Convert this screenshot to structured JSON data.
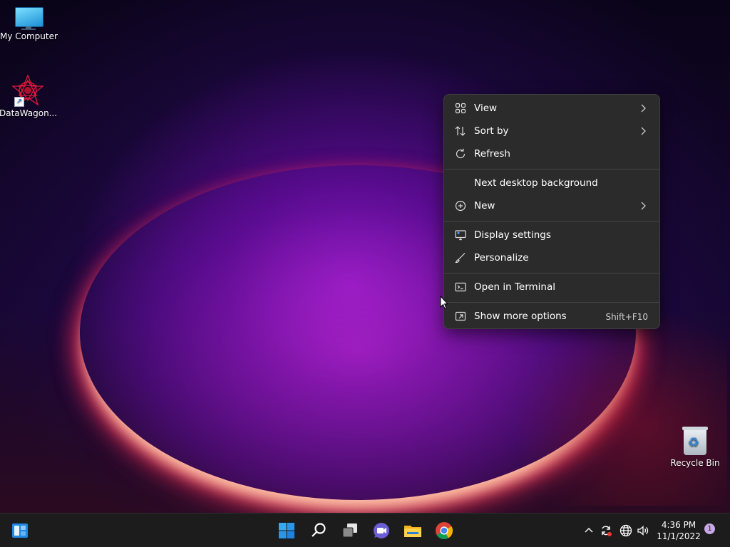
{
  "desktop": {
    "icons": [
      {
        "label": "My Computer"
      },
      {
        "label": "DataWagon..."
      },
      {
        "label": "Recycle Bin"
      }
    ]
  },
  "context_menu": {
    "items": [
      {
        "label": "View",
        "icon": "grid-icon",
        "submenu": true
      },
      {
        "label": "Sort by",
        "icon": "sort-arrows-icon",
        "submenu": true
      },
      {
        "label": "Refresh",
        "icon": "refresh-icon"
      },
      {
        "label": "Next desktop background"
      },
      {
        "label": "New",
        "icon": "plus-circle-icon",
        "submenu": true
      },
      {
        "label": "Display settings",
        "icon": "display-settings-icon"
      },
      {
        "label": "Personalize",
        "icon": "brush-icon"
      },
      {
        "label": "Open in Terminal",
        "icon": "terminal-icon"
      },
      {
        "label": "Show more options",
        "icon": "show-more-icon",
        "shortcut": "Shift+F10"
      }
    ]
  },
  "taskbar": {
    "apps": [
      "widgets-icon",
      "start-icon",
      "search-icon",
      "task-view-icon",
      "teams-chat-icon",
      "file-explorer-icon",
      "chrome-icon"
    ],
    "tray": [
      "chevron-up-icon",
      "sync-icon",
      "network-icon",
      "volume-icon"
    ],
    "clock": {
      "time": "4:36 PM",
      "date": "11/1/2022"
    },
    "notification_count": "1"
  },
  "colors": {
    "menu_bg": "#2b2b2b",
    "taskbar_bg": "#1c1c1c",
    "accent": "#0078d4"
  }
}
